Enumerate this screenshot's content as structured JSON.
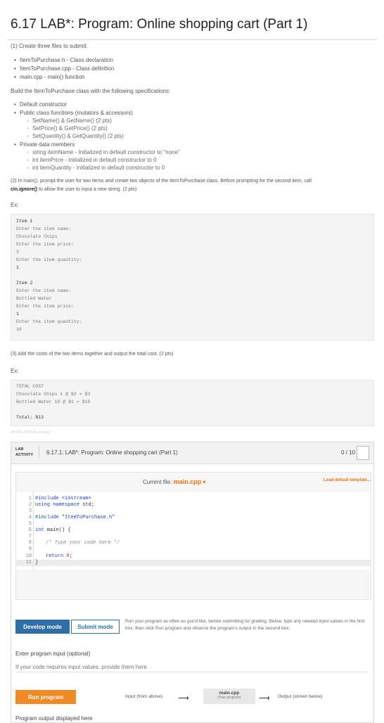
{
  "title": "6.17 LAB*: Program: Online shopping cart (Part 1)",
  "step1": {
    "heading": "(1) Create three files to submit.",
    "files": [
      "ItemToPurchase.h - Class declaration",
      "ItemToPurchase.cpp - Class definition",
      "main.cpp - main() function"
    ]
  },
  "spec_intro": "Build the ItemToPurchase class with the following specifications:",
  "spec": {
    "ctor": "Default constructor",
    "public_label": "Public class functions (mutators & accessors)",
    "public_items": [
      "SetName() & GetName() (2 pts)",
      "SetPrice() & GetPrice() (2 pts)",
      "SetQuantity() & GetQuantity() (2 pts)"
    ],
    "private_label": "Private data members",
    "private_items": [
      "string itemName - Initialized in default constructor to \"none\"",
      "int itemPrice - Initialized in default constructor to 0",
      "int itemQuantity - Initialized in default constructor to 0"
    ]
  },
  "step2": {
    "line1": "(2) In main(), prompt the user for two items and create two objects of the ItemToPurchase class. Before prompting for the second item, call",
    "bold": "cin.ignore()",
    "line2": " to allow the user to input a new string. (2 pts)"
  },
  "ex1_label": "Ex:",
  "ex1_lines": [
    "Item 1",
    "Enter the item name:",
    "Chocolate Chips",
    "Enter the item price:",
    "3",
    "Enter the item quantity:",
    "1",
    "",
    "Item 2",
    "Enter the item name:",
    "Bottled Water",
    "Enter the item price:",
    "1",
    "Enter the item quantity:",
    "10"
  ],
  "step3": "(3) Add the costs of the two items together and output the total cost. (2 pts)",
  "ex2_label": "Ex:",
  "ex2_lines": [
    "TOTAL COST",
    "Chocolate Chips 1 @ $3 = $3",
    "Bottled Water 10 @ $1 = $10",
    "",
    "Total: $13"
  ],
  "watermark": "487844.2344140.qx3zqy7",
  "lab": {
    "badge_line1": "LAB",
    "badge_line2": "ACTIVITY",
    "title": "6.17.1: LAB*: Program: Online shopping cart (Part 1)",
    "score": "0 / 10",
    "current_file_label": "Current file:",
    "current_file": "main.cpp",
    "load_default": "Load default template...",
    "line_numbers": [
      "1",
      "2",
      "3",
      "4",
      "5",
      "6",
      "7",
      "8",
      "9",
      "10",
      "11"
    ],
    "code": {
      "l1": "#include <iostream>",
      "l2a": "using namespace",
      "l2b": " std;",
      "l4": "#include \"ItemToPurchase.h\"",
      "l6a": "int",
      "l6b": " main() {",
      "l8": "/* Type your code here */",
      "l10a": "return",
      "l10b": "0",
      "l10c": ";",
      "l11": "}"
    },
    "develop_mode": "Develop mode",
    "submit_mode": "Submit mode",
    "mode_desc": "Run your program as often as you'd like, before submitting for grading. Below, type any needed input values in the first box, then click Run program and observe the program's output in the second box.",
    "input_label": "Enter program input (optional)",
    "input_placeholder": "If your code requires input values, provide them here.",
    "run_program": "Run program",
    "flow_input": "Input (from above)",
    "flow_main": "main.cpp",
    "flow_main_sub": "(Your program)",
    "flow_output": "Output (shown below)",
    "output_label": "Program output displayed here"
  }
}
